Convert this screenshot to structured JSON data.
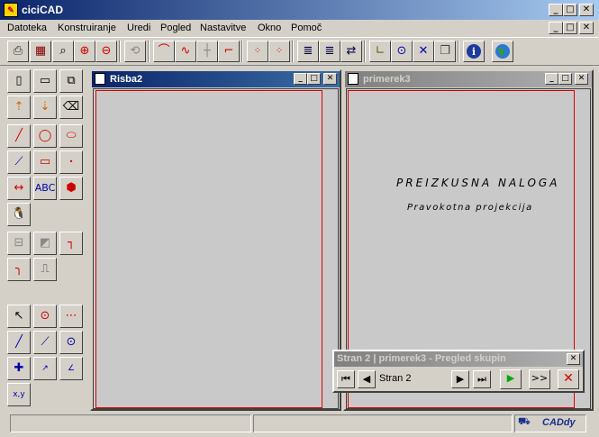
{
  "window": {
    "title": "ciciCAD"
  },
  "menu": [
    {
      "label": "Datoteka"
    },
    {
      "label": "Konstruiranje"
    },
    {
      "label": "Uredi"
    },
    {
      "label": "Pogled"
    },
    {
      "label": "Nastavitve"
    },
    {
      "label": "Okno"
    },
    {
      "label": "Pomoč"
    }
  ],
  "toolbar_icons": [
    "print-preview-icon",
    "calculator-icon",
    "zoom-window-icon",
    "zoom-in-icon",
    "zoom-out-icon",
    "snap-icon",
    "arc-icon",
    "polyline-icon",
    "grid-icon",
    "step-icon",
    "point-grid-icon",
    "point-query-icon",
    "layer-icon",
    "layer-query-icon",
    "layer-swap-icon",
    "ortho-icon",
    "circle-target-icon",
    "cross-snap-icon",
    "copy-view-icon",
    "info-icon",
    "globe-icon"
  ],
  "windows": {
    "left": {
      "title": "Risba2"
    },
    "right": {
      "title": "primerek3",
      "drawing_title": "PREIZKUSNA NALOGA",
      "drawing_subtitle": "Pravokotna projekcija"
    }
  },
  "palette": {
    "title": "Stran 2 | primerek3 - Pregled skupin",
    "page_value": "Stran 2",
    "next_label": ">>"
  },
  "left_toolbar": {
    "text_tool": "ABC",
    "coord_tool": "x,y"
  },
  "status": {
    "logo": "CADdy"
  },
  "colors": {
    "accent": "#0a246a",
    "frame_red": "#e00000"
  }
}
